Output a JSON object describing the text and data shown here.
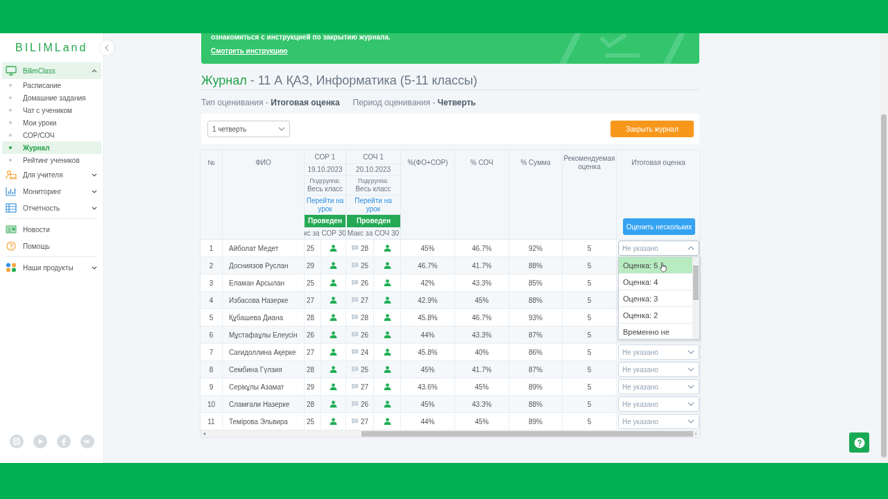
{
  "sidebar": {
    "logo": "BILIMLand",
    "sections": [
      [
        {
          "label": "BilimClass",
          "selected": true,
          "expanded": true,
          "children": [
            {
              "label": "Расписание",
              "selected": false
            },
            {
              "label": "Домашние задания",
              "selected": false
            },
            {
              "label": "Чат с учеником",
              "selected": false
            },
            {
              "label": "Мои уроки",
              "selected": false
            },
            {
              "label": "СОР/СОЧ",
              "selected": false
            },
            {
              "label": "Журнал",
              "selected": true
            },
            {
              "label": "Рейтинг учеников",
              "selected": false
            }
          ]
        },
        {
          "label": "Для учителя",
          "selected": false,
          "expanded": false
        },
        {
          "label": "Мониторинг",
          "selected": false,
          "expanded": false
        },
        {
          "label": "Отчетность",
          "selected": false,
          "expanded": false
        }
      ],
      [
        {
          "label": "Новости",
          "selected": false
        },
        {
          "label": "Помощь",
          "selected": false
        }
      ],
      [
        {
          "label": "Наши продукты",
          "selected": false,
          "expanded": false
        }
      ]
    ]
  },
  "banner": {
    "text": "ознакомиться с инструкцией по закрытию журнала.",
    "link": "Смотреть инструкцию"
  },
  "title": {
    "section": "Журнал",
    "text": "- 11 А ҚАЗ, Информатика (5-11 классы)"
  },
  "assessment_info": [
    "Тип оценивания - **Итоговая оценка**",
    "Период оценивания - **Четверть**"
  ],
  "toolbar": {
    "period_select": {
      "value": "1 четверть"
    },
    "close_button": "Закрыть журнал"
  },
  "table": {
    "lead_columns": [
      "№",
      "ФИО"
    ],
    "assessments": [
      {
        "title": "СОР 1",
        "date": "19.10.2023",
        "subgroup_label": "Подгруппа:",
        "subgroup": "Весь класс",
        "link": "Перейти на урок",
        "status": "Проведен",
        "max": "кс за СОР 30"
      },
      {
        "title": "СОЧ 1",
        "date": "20.10.2023",
        "subgroup_label": "Подгруппа:",
        "subgroup": "Весь класс",
        "link": "Перейти на урок",
        "status": "Проведен",
        "max": "Макс за СОЧ 30"
      }
    ],
    "result_columns": [
      {
        "label": "%(ФО+СОР)"
      },
      {
        "label": "% СОЧ"
      },
      {
        "label": "% Сумма"
      },
      {
        "label": "Рекомендуемая оценка"
      },
      {
        "label": "Итоговая оценка",
        "button": "Оценить нескольких"
      }
    ],
    "rows": [
      {
        "num": "1",
        "name": "Айболат Медет",
        "scores": [
          "25",
          "28"
        ],
        "fo_sor_pct": "45%",
        "soch_pct": "46.7%",
        "sum_pct": "92%",
        "recommended": "5",
        "final": {
          "placeholder": "Не указано",
          "expanded": true,
          "options": [
            {
              "label": "Оценка: 5",
              "selected": true
            },
            {
              "label": "Оценка: 4",
              "selected": false
            },
            {
              "label": "Оценка: 3",
              "selected": false
            },
            {
              "label": "Оценка: 2",
              "selected": false
            },
            {
              "label": "Временно не",
              "selected": false
            }
          ]
        }
      },
      {
        "num": "2",
        "name": "Досниязов Руслан",
        "scores": [
          "29",
          "25"
        ],
        "fo_sor_pct": "46.7%",
        "soch_pct": "41.7%",
        "sum_pct": "88%",
        "recommended": "5"
      },
      {
        "num": "3",
        "name": "Еламан Арсылан",
        "scores": [
          "25",
          "26"
        ],
        "fo_sor_pct": "42%",
        "soch_pct": "43.3%",
        "sum_pct": "85%",
        "recommended": "5"
      },
      {
        "num": "4",
        "name": "Избасова Назерке",
        "scores": [
          "27",
          "27"
        ],
        "fo_sor_pct": "42.9%",
        "soch_pct": "45%",
        "sum_pct": "88%",
        "recommended": "5"
      },
      {
        "num": "5",
        "name": "Құбашева Диана",
        "scores": [
          "28",
          "28"
        ],
        "fo_sor_pct": "45.8%",
        "soch_pct": "46.7%",
        "sum_pct": "93%",
        "recommended": "5"
      },
      {
        "num": "6",
        "name": "Мұстафаұлы Елеусін",
        "scores": [
          "26",
          "26"
        ],
        "fo_sor_pct": "44%",
        "soch_pct": "43.3%",
        "sum_pct": "87%",
        "recommended": "5"
      },
      {
        "num": "7",
        "name": "Сағидоллина Ақерке",
        "scores": [
          "27",
          "24"
        ],
        "fo_sor_pct": "45.8%",
        "soch_pct": "40%",
        "sum_pct": "86%",
        "recommended": "5",
        "final": {
          "placeholder": "Не указано",
          "expanded": false
        }
      },
      {
        "num": "8",
        "name": "Сембина Гүлзия",
        "scores": [
          "28",
          "25"
        ],
        "fo_sor_pct": "45%",
        "soch_pct": "41.7%",
        "sum_pct": "87%",
        "recommended": "5",
        "final": {
          "placeholder": "Не указано",
          "expanded": false
        }
      },
      {
        "num": "9",
        "name": "Серікұлы Азамат",
        "scores": [
          "29",
          "27"
        ],
        "fo_sor_pct": "43.6%",
        "soch_pct": "45%",
        "sum_pct": "89%",
        "recommended": "5",
        "final": {
          "placeholder": "Не указано",
          "expanded": false
        }
      },
      {
        "num": "10",
        "name": "Сламғали Назерке",
        "scores": [
          "28",
          "26"
        ],
        "fo_sor_pct": "45%",
        "soch_pct": "43.3%",
        "sum_pct": "88%",
        "recommended": "5",
        "final": {
          "placeholder": "Не указано",
          "expanded": false
        }
      },
      {
        "num": "11",
        "name": "Темірова Эльвира",
        "scores": [
          "25",
          "27"
        ],
        "fo_sor_pct": "44%",
        "soch_pct": "45%",
        "sum_pct": "89%",
        "recommended": "5",
        "final": {
          "placeholder": "Не указано",
          "expanded": false
        }
      }
    ]
  }
}
